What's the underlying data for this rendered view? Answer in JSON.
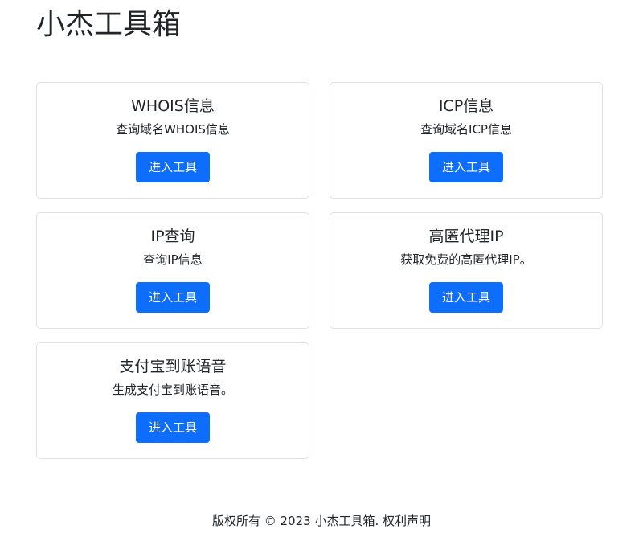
{
  "site": {
    "title": "小杰工具箱"
  },
  "tools": [
    {
      "title": "WHOIS信息",
      "description": "查询域名WHOIS信息",
      "button_label": "进入工具"
    },
    {
      "title": "ICP信息",
      "description": "查询域名ICP信息",
      "button_label": "进入工具"
    },
    {
      "title": "IP查询",
      "description": "查询IP信息",
      "button_label": "进入工具"
    },
    {
      "title": "高匿代理IP",
      "description": "获取免费的高匿代理IP。",
      "button_label": "进入工具"
    },
    {
      "title": "支付宝到账语音",
      "description": "生成支付宝到账语音。",
      "button_label": "进入工具"
    }
  ],
  "footer": {
    "copyright": "版权所有 © 2023 小杰工具箱.",
    "rights_link": "权利声明"
  },
  "colors": {
    "primary_button": "#0d6efd",
    "card_border": "#dee2e6",
    "text": "#212529"
  }
}
